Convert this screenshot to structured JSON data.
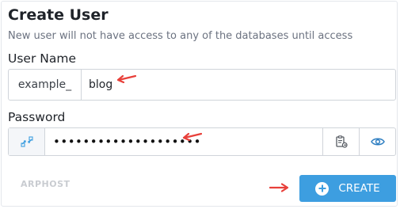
{
  "form": {
    "title": "Create User",
    "subtitle": "New user will not have access to any of the databases until access",
    "username": {
      "label": "User Name",
      "prefix": "example_",
      "value": "blog"
    },
    "password": {
      "label": "Password",
      "value": "••••••••••••••••••••",
      "left_icon": "generate-password-icon",
      "right_icons": [
        "copy-clipboard-icon",
        "eye-icon"
      ]
    },
    "create_label": "CREATE",
    "create_icon": "plus-circle-icon"
  },
  "watermark": {
    "text": "ARPHOST"
  },
  "colors": {
    "accent": "#3d9ee0",
    "annotation_arrow": "#e8403a",
    "text": "#1f2329",
    "muted": "#6b7280",
    "border": "#d0d4da"
  }
}
